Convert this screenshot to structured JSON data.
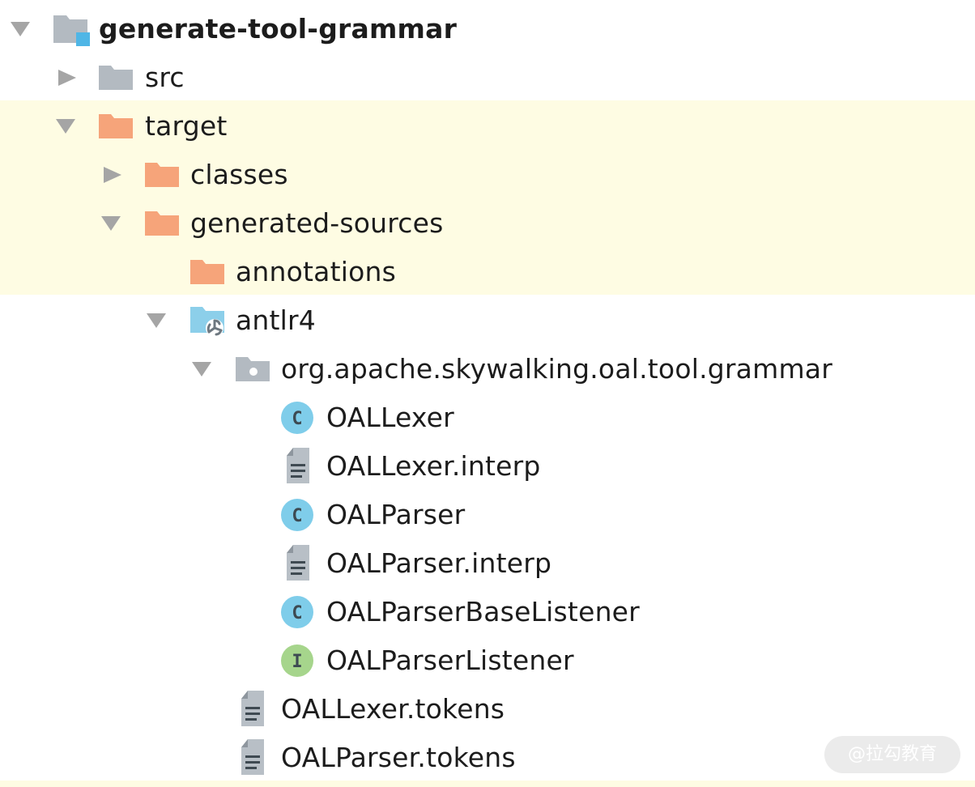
{
  "tree": {
    "items": [
      {
        "label": "generate-tool-grammar",
        "icon": "module-folder-icon",
        "state": "expanded",
        "highlighted": false
      },
      {
        "label": "src",
        "icon": "folder-icon",
        "state": "collapsed",
        "highlighted": false
      },
      {
        "label": "target",
        "icon": "excluded-folder-icon",
        "state": "expanded",
        "highlighted": true
      },
      {
        "label": "classes",
        "icon": "excluded-folder-icon",
        "state": "collapsed",
        "highlighted": true
      },
      {
        "label": "generated-sources",
        "icon": "excluded-folder-icon",
        "state": "expanded",
        "highlighted": true
      },
      {
        "label": "annotations",
        "icon": "excluded-folder-icon",
        "state": "leaf",
        "highlighted": true
      },
      {
        "label": "antlr4",
        "icon": "generated-source-folder-icon",
        "state": "expanded",
        "highlighted": false
      },
      {
        "label": "org.apache.skywalking.oal.tool.grammar",
        "icon": "package-icon",
        "state": "expanded",
        "highlighted": false
      },
      {
        "label": "OALLexer",
        "icon": "class-icon",
        "state": "leaf",
        "highlighted": false
      },
      {
        "label": "OALLexer.interp",
        "icon": "text-file-icon",
        "state": "leaf",
        "highlighted": false
      },
      {
        "label": "OALParser",
        "icon": "class-icon",
        "state": "leaf",
        "highlighted": false
      },
      {
        "label": "OALParser.interp",
        "icon": "text-file-icon",
        "state": "leaf",
        "highlighted": false
      },
      {
        "label": "OALParserBaseListener",
        "icon": "class-icon",
        "state": "leaf",
        "highlighted": false
      },
      {
        "label": "OALParserListener",
        "icon": "interface-icon",
        "state": "leaf",
        "highlighted": false
      },
      {
        "label": "OALLexer.tokens",
        "icon": "text-file-icon",
        "state": "leaf",
        "highlighted": false
      },
      {
        "label": "OALParser.tokens",
        "icon": "text-file-icon",
        "state": "leaf",
        "highlighted": false
      }
    ],
    "class_badge": "C",
    "interface_badge": "I"
  },
  "watermark": "@拉勾教育",
  "colors": {
    "highlight_band": "#fefce3",
    "excluded_folder": "#f6a47a",
    "folder": "#b3bac1",
    "class_badge": "#7fcdea",
    "interface_badge": "#a6d58c",
    "generated_folder": "#8ccfea"
  }
}
